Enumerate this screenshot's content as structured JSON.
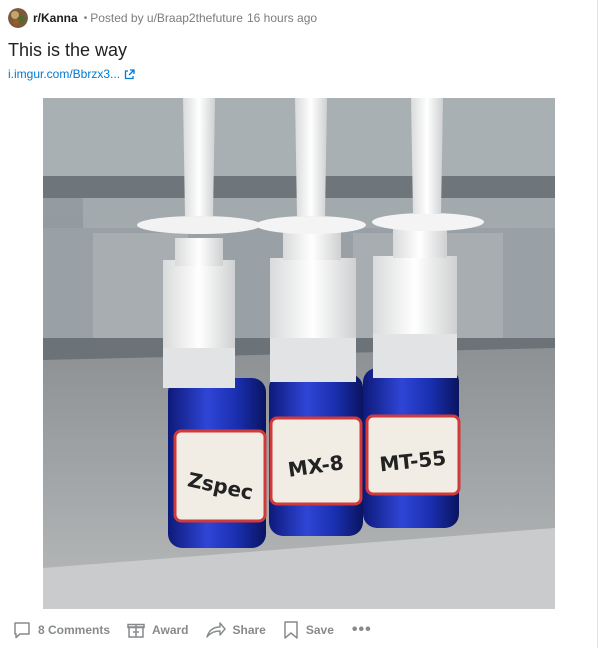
{
  "post": {
    "subreddit": "r/Kanna",
    "separator": "•",
    "posted_by": "Posted by u/Braap2thefuture",
    "time": "16 hours ago",
    "title": "This is the way",
    "link_text": "i.imgur.com/Bbrzx3...",
    "image_labels": [
      "Zspec",
      "MX-8",
      "MT-55"
    ]
  },
  "actions": {
    "comments": "8 Comments",
    "award": "Award",
    "share": "Share",
    "save": "Save",
    "more": "•••"
  },
  "colors": {
    "link": "#0079d3",
    "meta": "#7c7c7c",
    "action": "#878a8c",
    "bottle": "#1a2fb0"
  }
}
